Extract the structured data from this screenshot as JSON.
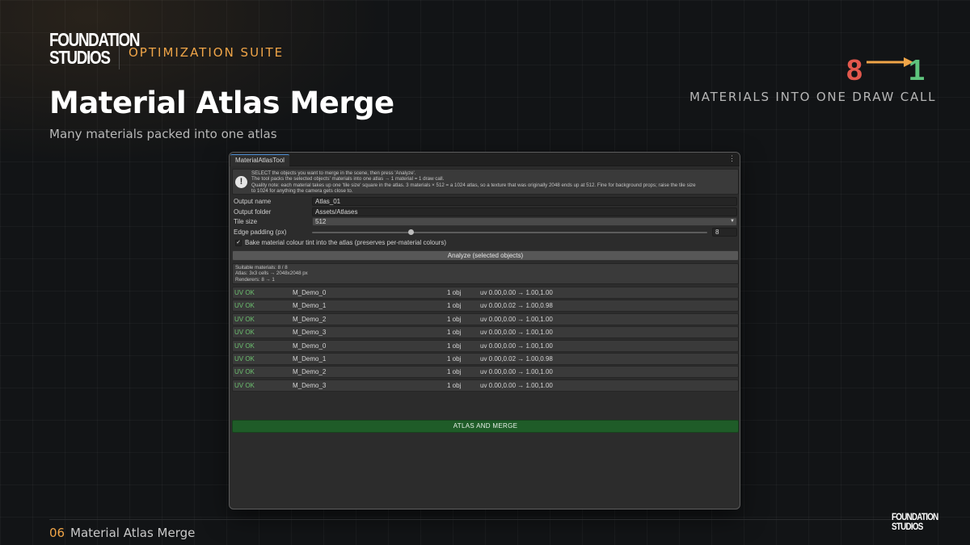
{
  "brand": {
    "logo_line1": "FOUNDATION",
    "logo_line2": "STUDIOS",
    "suite": "OPTIMIZATION SUITE"
  },
  "slide": {
    "title": "Material Atlas Merge",
    "subtitle": "Many materials packed into one atlas"
  },
  "stat": {
    "from": "8",
    "to": "1",
    "caption": "MATERIALS INTO ONE DRAW CALL"
  },
  "colors": {
    "accent": "#f0a548",
    "from_color": "#e2584d",
    "to_color": "#5ec47d",
    "ok_color": "#6cc06f",
    "merge_button": "#1f5c28"
  },
  "window": {
    "tab": "MaterialAtlasTool",
    "menu_icon": "kebab-menu-icon",
    "help": {
      "icon": "info-icon",
      "lines": [
        "SELECT the objects you want to merge in the scene, then press 'Analyze'.",
        "The tool packs the selected objects' materials into one atlas → 1 material = 1 draw call.",
        "Quality note: each material takes up one 'tile size' square in the atlas. 3 materials × 512 = a 1024 atlas, so a texture that was originally 2048 ends up at 512. Fine for background props; raise the tile size",
        "to 1024 for anything the camera gets close to."
      ]
    },
    "fields": {
      "output_name": {
        "label": "Output name",
        "value": "Atlas_01"
      },
      "output_folder": {
        "label": "Output folder",
        "value": "Assets/Atlases"
      },
      "tile_size": {
        "label": "Tile size",
        "value": "512"
      },
      "edge_padding": {
        "label": "Edge padding (px)",
        "value": "8",
        "slider_fraction": 0.25
      }
    },
    "bake_option": {
      "label": "Bake material colour tint into the atlas (preserves per-material colours)",
      "checked": true
    },
    "analyze_button": "Analyze (selected objects)",
    "summary": {
      "suitable": "Suitable materials: 8 / 8",
      "atlas": "Atlas: 3x3 cells → 2048x2048 px",
      "renderers": "Renderers: 8 → 1"
    },
    "rows": [
      {
        "status": "UV OK",
        "material": "M_Demo_0",
        "count": "1 obj",
        "uv": "uv 0.00,0.00 → 1.00,1.00"
      },
      {
        "status": "UV OK",
        "material": "M_Demo_1",
        "count": "1 obj",
        "uv": "uv 0.00,0.02 → 1.00,0.98"
      },
      {
        "status": "UV OK",
        "material": "M_Demo_2",
        "count": "1 obj",
        "uv": "uv 0.00,0.00 → 1.00,1.00"
      },
      {
        "status": "UV OK",
        "material": "M_Demo_3",
        "count": "1 obj",
        "uv": "uv 0.00,0.00 → 1.00,1.00"
      },
      {
        "status": "UV OK",
        "material": "M_Demo_0",
        "count": "1 obj",
        "uv": "uv 0.00,0.00 → 1.00,1.00"
      },
      {
        "status": "UV OK",
        "material": "M_Demo_1",
        "count": "1 obj",
        "uv": "uv 0.00,0.02 → 1.00,0.98"
      },
      {
        "status": "UV OK",
        "material": "M_Demo_2",
        "count": "1 obj",
        "uv": "uv 0.00,0.00 → 1.00,1.00"
      },
      {
        "status": "UV OK",
        "material": "M_Demo_3",
        "count": "1 obj",
        "uv": "uv 0.00,0.00 → 1.00,1.00"
      }
    ],
    "merge_button": "ATLAS AND MERGE"
  },
  "footer": {
    "number": "06",
    "title": "Material Atlas Merge"
  }
}
